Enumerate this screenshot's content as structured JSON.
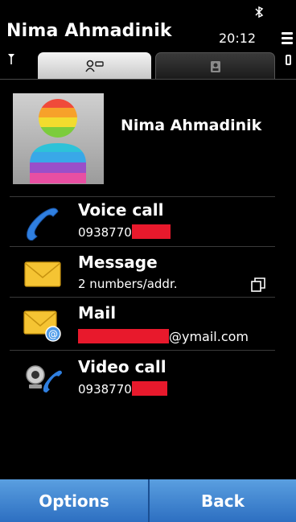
{
  "status": {
    "title": "Nima Ahmadinik",
    "time": "20:12"
  },
  "tabs": [
    {
      "icon": "contact-details-icon",
      "active": true
    },
    {
      "icon": "contact-card-icon",
      "active": false
    }
  ],
  "contact": {
    "name": "Nima Ahmadinik"
  },
  "actions": [
    {
      "label": "Voice call",
      "detail": "0938770",
      "icon": "phone-handset-icon"
    },
    {
      "label": "Message",
      "detail": "2 numbers/addr.",
      "icon": "envelope-icon"
    },
    {
      "label": "Mail",
      "detail": "@ymail.com",
      "icon": "email-at-icon"
    },
    {
      "label": "Video call",
      "detail": "0938770",
      "icon": "video-call-icon"
    }
  ],
  "softkeys": {
    "left": "Options",
    "right": "Back"
  },
  "colors": {
    "accent": "#3d86d6",
    "redaction": "#e8192c"
  }
}
